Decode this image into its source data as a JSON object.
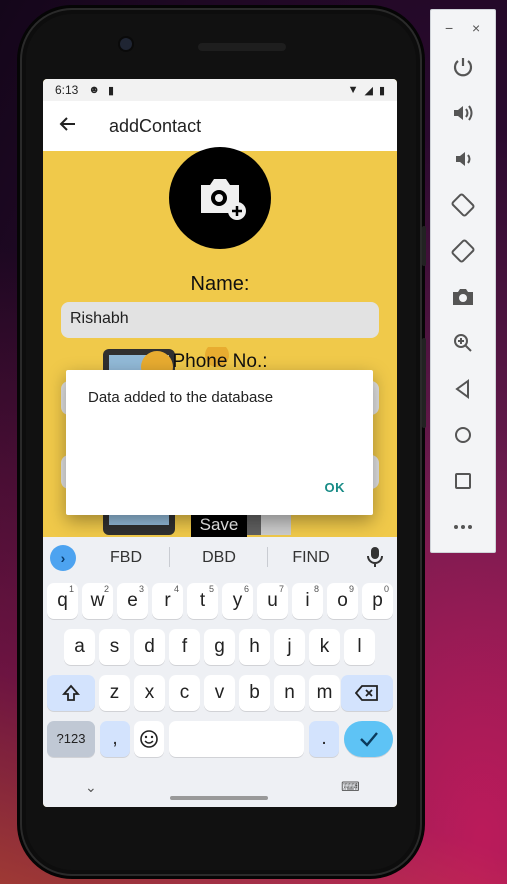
{
  "status_bar": {
    "time": "6:13"
  },
  "app_bar": {
    "title": "addContact"
  },
  "form": {
    "name_label": "Name:",
    "name_value": "Rishabh",
    "phone_label": "Phone No.:",
    "save_label": "Save"
  },
  "dialog": {
    "message": "Data added to the database",
    "ok_label": "OK"
  },
  "keyboard": {
    "suggestions": [
      "FBD",
      "DBD",
      "FIND"
    ],
    "row1": [
      {
        "k": "q",
        "n": "1"
      },
      {
        "k": "w",
        "n": "2"
      },
      {
        "k": "e",
        "n": "3"
      },
      {
        "k": "r",
        "n": "4"
      },
      {
        "k": "t",
        "n": "5"
      },
      {
        "k": "y",
        "n": "6"
      },
      {
        "k": "u",
        "n": "7"
      },
      {
        "k": "i",
        "n": "8"
      },
      {
        "k": "o",
        "n": "9"
      },
      {
        "k": "p",
        "n": "0"
      }
    ],
    "row2": [
      "a",
      "s",
      "d",
      "f",
      "g",
      "h",
      "j",
      "k",
      "l"
    ],
    "row3": [
      "z",
      "x",
      "c",
      "v",
      "b",
      "n",
      "m"
    ],
    "sym_label": "?123",
    "comma_label": ",",
    "period_label": "."
  },
  "emulator_panel": {
    "tools": [
      "power-icon",
      "volume-up-icon",
      "volume-down-icon",
      "rotate-left-icon",
      "rotate-right-icon",
      "camera-icon",
      "zoom-icon",
      "back-icon",
      "home-icon",
      "overview-icon",
      "more-icon"
    ]
  },
  "colors": {
    "screen_bg": "#ffd64f",
    "accent_ok": "#188b86",
    "enter_key": "#5ec3f5"
  }
}
